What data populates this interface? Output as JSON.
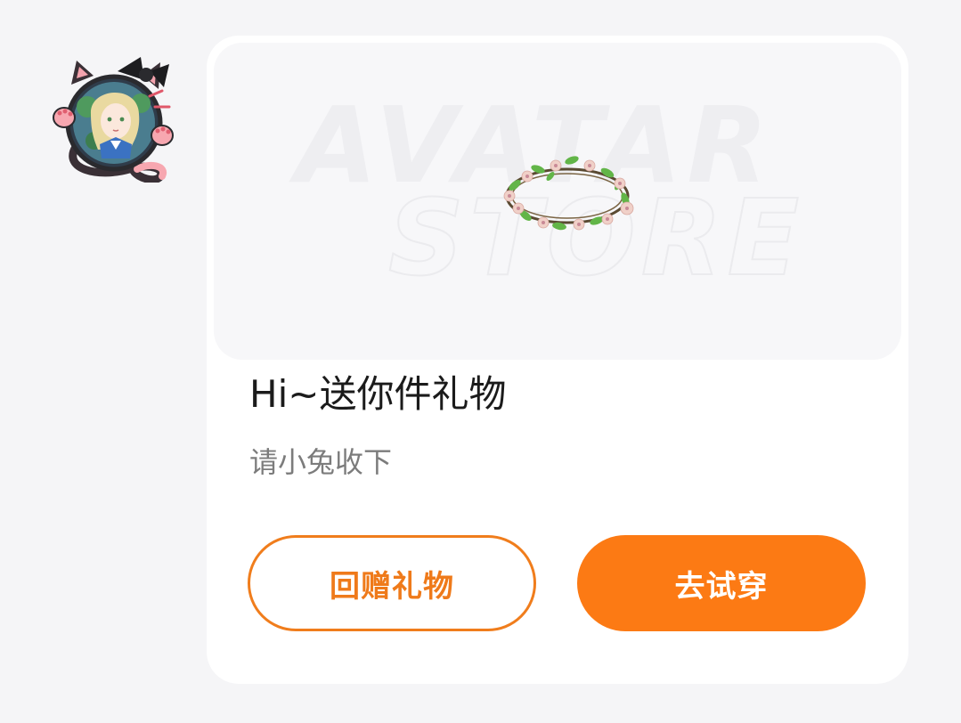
{
  "card": {
    "banner_watermark_line1": "AVATAR",
    "banner_watermark_line2": "STORE",
    "title": "Hi~送你件礼物",
    "subtitle": "请小兔收下",
    "secondary_button_label": "回赠礼物",
    "primary_button_label": "去试穿"
  },
  "colors": {
    "page_background": "#f5f5f7",
    "card_background": "#ffffff",
    "accent_orange": "#fc7a14",
    "title_text": "#1b1b1b",
    "subtitle_text": "#7c7c7c"
  },
  "icons": {
    "sender_avatar": "cat-ear-avatar-icon",
    "gift_item": "flower-wreath-icon"
  }
}
